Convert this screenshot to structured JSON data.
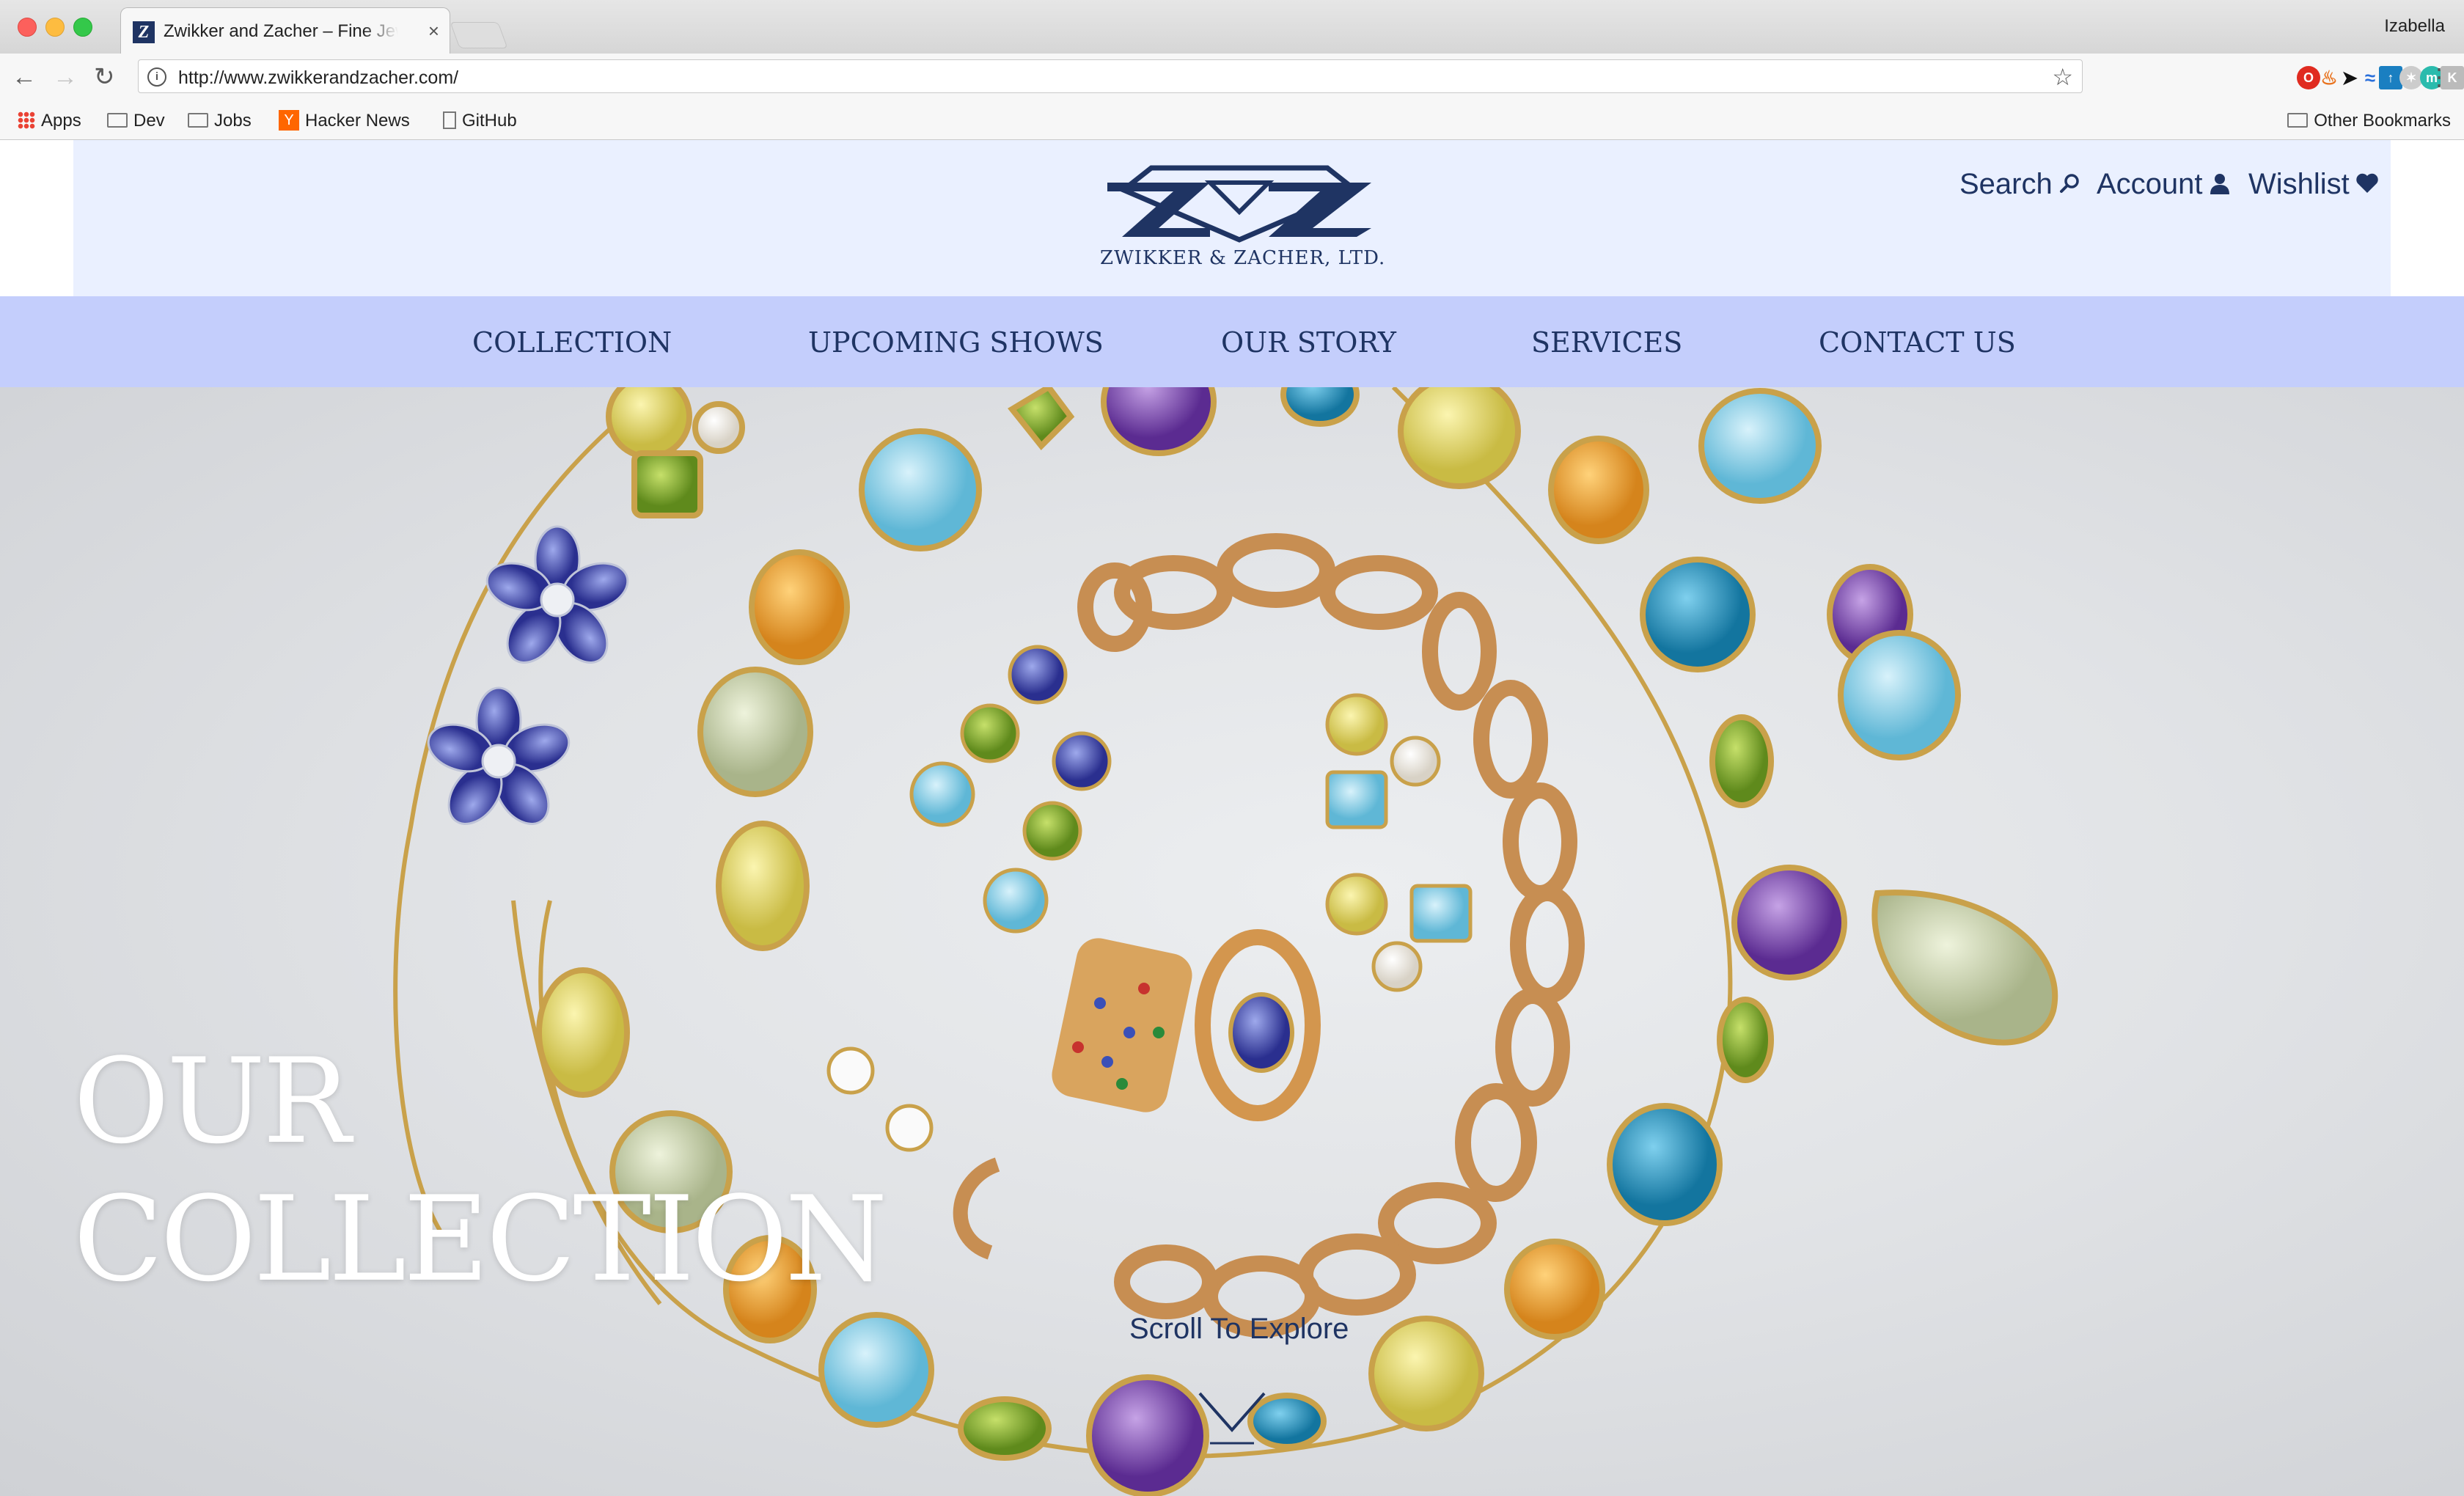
{
  "browser": {
    "tab_title": "Zwikker and Zacher – Fine Jewelry",
    "tab_close": "×",
    "favicon_letter": "Z",
    "profile_name": "Izabella",
    "url": "http://www.zwikkerandzacher.com/",
    "bookmarks": {
      "apps": "Apps",
      "dev": "Dev",
      "jobs": "Jobs",
      "hacker_news": "Hacker News",
      "github": "GitHub",
      "other": "Other Bookmarks"
    },
    "hn_letter": "Y"
  },
  "site": {
    "logo_text": "ZWIKKER & ZACHER, LTD.",
    "utility": {
      "search": "Search",
      "account": "Account",
      "wishlist": "Wishlist"
    },
    "nav": [
      "COLLECTION",
      "UPCOMING SHOWS",
      "OUR STORY",
      "SERVICES",
      "CONTACT US"
    ],
    "hero": {
      "title_line1": "OUR",
      "title_line2": "COLLECTION",
      "scroll_text": "Scroll To Explore"
    },
    "colors": {
      "brand_navy": "#1f3463",
      "header_bg": "#eaf0ff",
      "nav_bg": "#c4cefc"
    }
  }
}
